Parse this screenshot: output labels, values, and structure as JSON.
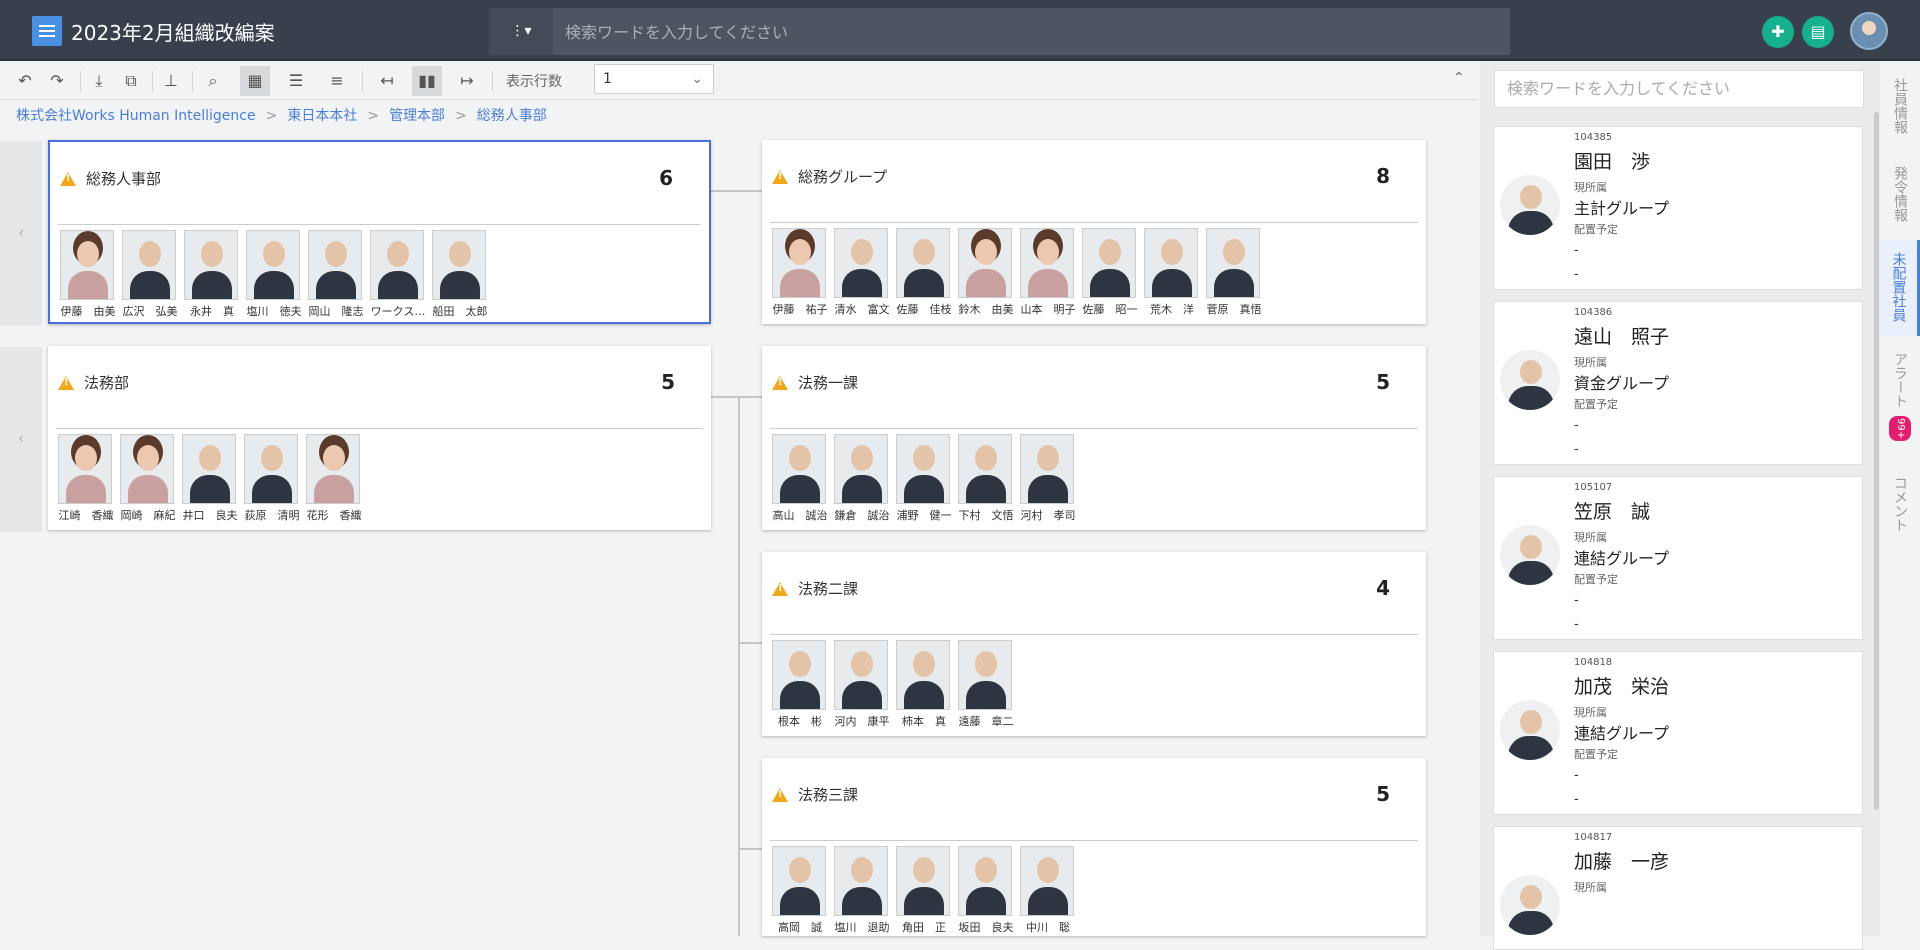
{
  "header": {
    "title": "2023年2月組織改編案",
    "search_mode": "⋮▾",
    "search_placeholder": "検索ワードを入力してください"
  },
  "toolbar": {
    "rows_label": "表示行数",
    "rows_value": "1"
  },
  "breadcrumb": [
    "株式会社Works Human Intelligence",
    "東日本本社",
    "管理本部",
    "総務人事部"
  ],
  "org": {
    "cards": [
      {
        "title": "総務人事部",
        "count": "6",
        "people": [
          "伊藤　由美",
          "広沢　弘美",
          "永井　真",
          "塩川　徳夫",
          "岡山　隆志",
          "ワークス…",
          "船田　太郎"
        ]
      },
      {
        "title": "総務グループ",
        "count": "8",
        "people": [
          "伊藤　祐子",
          "清水　富文",
          "佐藤　佳枝",
          "鈴木　由美",
          "山本　明子",
          "佐藤　昭一",
          "荒木　洋",
          "菅原　真悟"
        ]
      },
      {
        "title": "法務部",
        "count": "5",
        "people": [
          "江崎　香織",
          "岡崎　麻紀",
          "井口　良夫",
          "荻原　清明",
          "花形　香織"
        ]
      },
      {
        "title": "法務一課",
        "count": "5",
        "people": [
          "高山　誠治",
          "鎌倉　誠治",
          "浦野　健一",
          "下村　文悟",
          "河村　孝司"
        ]
      },
      {
        "title": "法務二課",
        "count": "4",
        "people": [
          "根本　彬",
          "河内　康平",
          "柿本　真",
          "遠藤　章二"
        ]
      },
      {
        "title": "法務三課",
        "count": "5",
        "people": [
          "高岡　誠",
          "塩川　退助",
          "角田　正",
          "坂田　良夫",
          "中川　聡"
        ]
      }
    ]
  },
  "right_panel": {
    "search_placeholder": "検索ワードを入力してください",
    "employees": [
      {
        "id": "104385",
        "name": "園田　渉",
        "current_label": "現所属",
        "group": "主計グループ",
        "plan_label": "配置予定",
        "d1": "-",
        "d2": "-"
      },
      {
        "id": "104386",
        "name": "遠山　照子",
        "current_label": "現所属",
        "group": "資金グループ",
        "plan_label": "配置予定",
        "d1": "-",
        "d2": "-"
      },
      {
        "id": "105107",
        "name": "笠原　誠",
        "current_label": "現所属",
        "group": "連結グループ",
        "plan_label": "配置予定",
        "d1": "-",
        "d2": "-"
      },
      {
        "id": "104818",
        "name": "加茂　栄治",
        "current_label": "現所属",
        "group": "連結グループ",
        "plan_label": "配置予定",
        "d1": "-",
        "d2": "-"
      },
      {
        "id": "104817",
        "name": "加藤　一彦",
        "current_label": "現所属",
        "group": "",
        "plan_label": "",
        "d1": "",
        "d2": ""
      }
    ]
  },
  "vtabs": [
    {
      "label": "社員情報"
    },
    {
      "label": "発令情報"
    },
    {
      "label": "未配置社員"
    },
    {
      "label": "アラート",
      "badge": "99+"
    },
    {
      "label": "コメント"
    }
  ],
  "colors": {
    "accent": "#4a7fd6",
    "topbar": "#38414b",
    "green": "#16b08f",
    "warn": "#f0a81c",
    "badge": "#e21f6e"
  }
}
